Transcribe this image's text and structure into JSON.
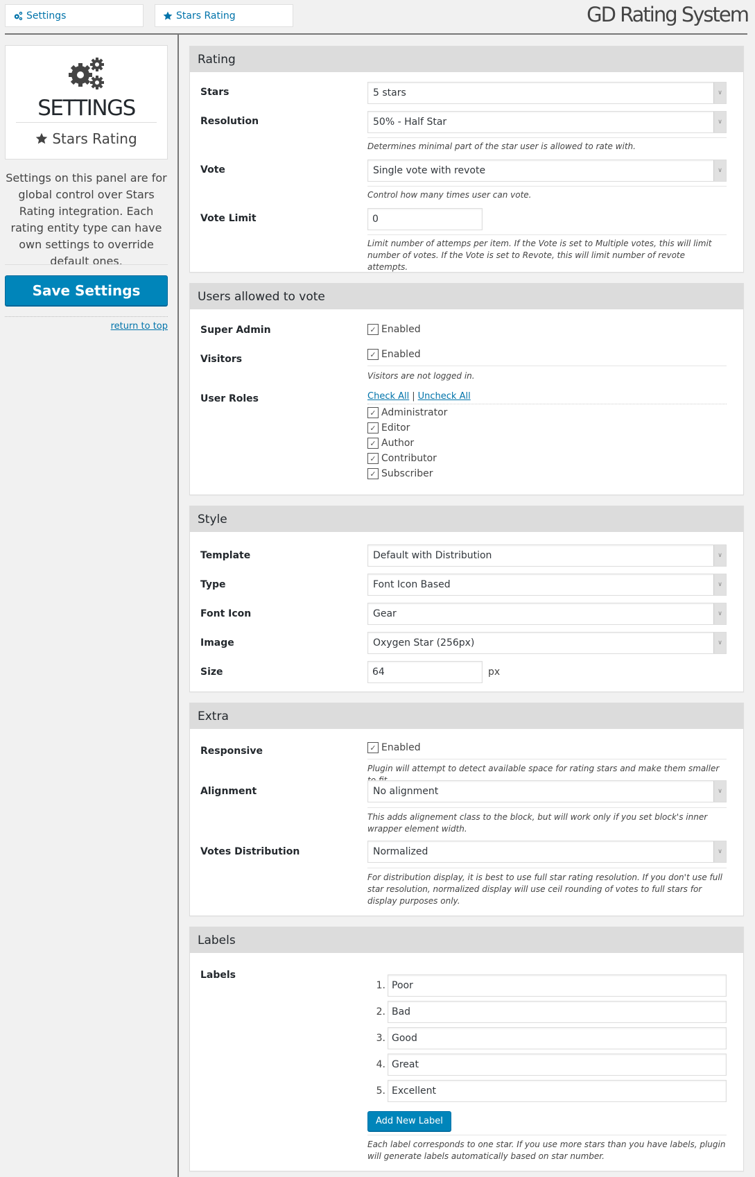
{
  "tabs": [
    {
      "label": "Settings",
      "icon": "gears-icon"
    },
    {
      "label": "Stars Rating",
      "icon": "star-icon"
    }
  ],
  "logo": "GD Rating System",
  "sidebar": {
    "title": "SETTINGS",
    "subtitle": "Stars Rating",
    "description": "Settings on this panel are for global control over Stars Rating integration. Each rating entity type can have own settings to override default ones.",
    "save_label": "Save Settings",
    "return_label": "return to top"
  },
  "sections": {
    "rating": {
      "title": "Rating",
      "stars": {
        "label": "Stars",
        "value": "5 stars"
      },
      "resolution": {
        "label": "Resolution",
        "value": "50% - Half Star",
        "desc": "Determines minimal part of the star user is allowed to rate with."
      },
      "vote": {
        "label": "Vote",
        "value": "Single vote with revote",
        "desc": "Control how many times user can vote."
      },
      "vote_limit": {
        "label": "Vote Limit",
        "value": "0",
        "desc": "Limit number of attemps per item. If the Vote is set to Multiple votes, this will limit number of votes. If the Vote is set to Revote, this will limit number of revote attempts."
      }
    },
    "users": {
      "title": "Users allowed to vote",
      "super_admin": {
        "label": "Super Admin",
        "check_label": "Enabled",
        "checked": true
      },
      "visitors": {
        "label": "Visitors",
        "check_label": "Enabled",
        "checked": true,
        "desc": "Visitors are not logged in."
      },
      "roles": {
        "label": "User Roles",
        "check_all": "Check All",
        "uncheck_all": "Uncheck All",
        "separator": "|",
        "items": [
          {
            "label": "Administrator",
            "checked": true
          },
          {
            "label": "Editor",
            "checked": true
          },
          {
            "label": "Author",
            "checked": true
          },
          {
            "label": "Contributor",
            "checked": true
          },
          {
            "label": "Subscriber",
            "checked": true
          }
        ]
      }
    },
    "style": {
      "title": "Style",
      "template": {
        "label": "Template",
        "value": "Default with Distribution"
      },
      "type": {
        "label": "Type",
        "value": "Font Icon Based"
      },
      "font_icon": {
        "label": "Font Icon",
        "value": "Gear"
      },
      "image": {
        "label": "Image",
        "value": "Oxygen Star (256px)"
      },
      "size": {
        "label": "Size",
        "value": "64",
        "unit": "px"
      }
    },
    "extra": {
      "title": "Extra",
      "responsive": {
        "label": "Responsive",
        "check_label": "Enabled",
        "checked": true,
        "desc": "Plugin will attempt to detect available space for rating stars and make them smaller to fit."
      },
      "alignment": {
        "label": "Alignment",
        "value": "No alignment",
        "desc": "This adds alignement class to the block, but will work only if you set block's inner wrapper element width."
      },
      "distribution": {
        "label": "Votes Distribution",
        "value": "Normalized",
        "desc": "For distribution display, it is best to use full star rating resolution. If you don't use full star resolution, normalized display will use ceil rounding of votes to full stars for display purposes only."
      }
    },
    "labels": {
      "title": "Labels",
      "label": "Labels",
      "items": [
        {
          "num": "1.",
          "value": "Poor"
        },
        {
          "num": "2.",
          "value": "Bad"
        },
        {
          "num": "3.",
          "value": "Good"
        },
        {
          "num": "4.",
          "value": "Great"
        },
        {
          "num": "5.",
          "value": "Excellent"
        }
      ],
      "add_label": "Add New Label",
      "desc": "Each label corresponds to one star. If you use more stars than you have labels, plugin will generate labels automatically based on star number."
    }
  },
  "colors": {
    "accent": "#0085ba",
    "link": "#0073aa",
    "header_band": "#dcdcdc",
    "background": "#f1f1f1"
  }
}
